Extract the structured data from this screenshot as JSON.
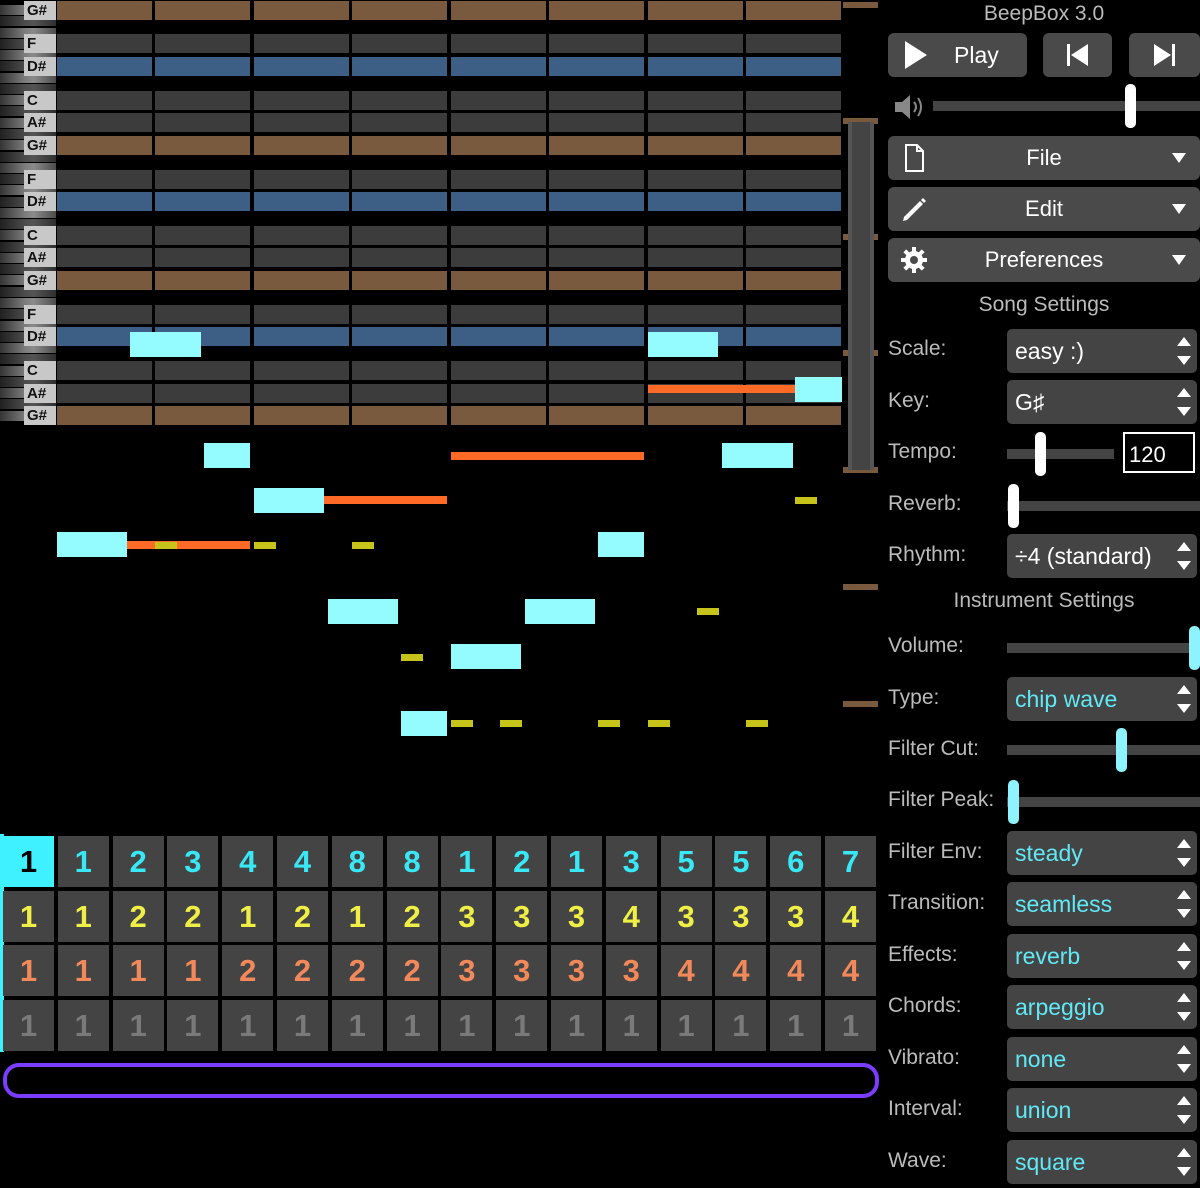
{
  "app": {
    "title": "BeepBox 3.0"
  },
  "transport": {
    "play_label": "Play",
    "prev_icon": "skip-back-icon",
    "next_icon": "skip-forward-icon",
    "volume_icon": "speaker-icon"
  },
  "menus": {
    "file": "File",
    "edit": "Edit",
    "preferences": "Preferences"
  },
  "song_settings": {
    "heading": "Song Settings",
    "scale_label": "Scale:",
    "scale_value": "easy :)",
    "key_label": "Key:",
    "key_value": "G♯",
    "tempo_label": "Tempo:",
    "tempo_value": "120",
    "reverb_label": "Reverb:",
    "rhythm_label": "Rhythm:",
    "rhythm_value": "÷4 (standard)"
  },
  "instrument_settings": {
    "heading": "Instrument Settings",
    "volume_label": "Volume:",
    "type_label": "Type:",
    "type_value": "chip wave",
    "filter_cut_label": "Filter Cut:",
    "filter_peak_label": "Filter Peak:",
    "filter_env_label": "Filter Env:",
    "filter_env_value": "steady",
    "transition_label": "Transition:",
    "transition_value": "seamless",
    "effects_label": "Effects:",
    "effects_value": "reverb",
    "chords_label": "Chords:",
    "chords_value": "arpeggio",
    "vibrato_label": "Vibrato:",
    "vibrato_value": "none",
    "interval_label": "Interval:",
    "interval_value": "union",
    "wave_label": "Wave:",
    "wave_value": "square"
  },
  "piano_keys": [
    "G#",
    "F",
    "D#",
    "C",
    "A#",
    "G#",
    "F",
    "D#",
    "C",
    "A#",
    "G#",
    "F",
    "D#",
    "C",
    "A#",
    "G#"
  ],
  "tracks": [
    [
      "1",
      "1",
      "2",
      "3",
      "4",
      "4",
      "8",
      "8",
      "1",
      "2",
      "1",
      "3",
      "5",
      "5",
      "6",
      "7"
    ],
    [
      "1",
      "1",
      "2",
      "2",
      "1",
      "2",
      "1",
      "2",
      "3",
      "3",
      "3",
      "4",
      "3",
      "3",
      "3",
      "4"
    ],
    [
      "1",
      "1",
      "1",
      "1",
      "2",
      "2",
      "2",
      "2",
      "3",
      "3",
      "3",
      "3",
      "4",
      "4",
      "4",
      "4"
    ],
    [
      "1",
      "1",
      "1",
      "1",
      "1",
      "1",
      "1",
      "1",
      "1",
      "1",
      "1",
      "1",
      "1",
      "1",
      "1",
      "1"
    ]
  ],
  "colors": {
    "accent": "#3ff0ff",
    "note": "#94fcff",
    "loop": "#7a3cff",
    "channel1": "#39e8f5",
    "channel2": "#f0ef45",
    "channel3": "#f2895a",
    "drums": "#7a7a7a"
  }
}
